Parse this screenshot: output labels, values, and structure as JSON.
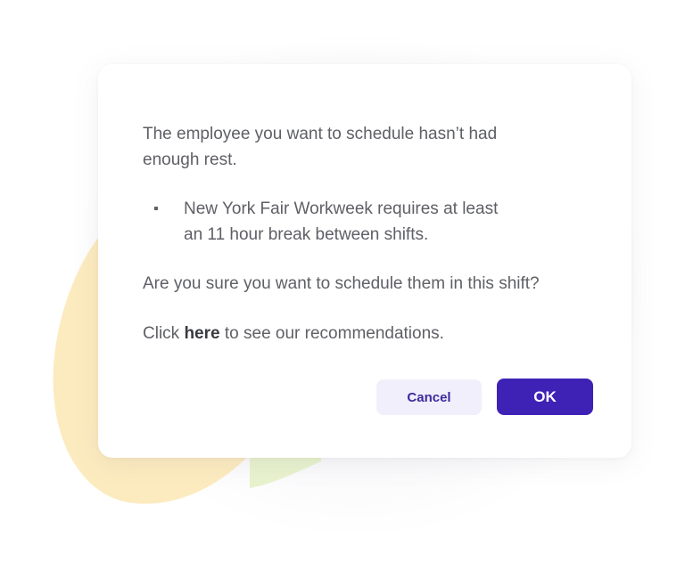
{
  "dialog": {
    "message_line1": "The employee you want to schedule hasn’t had",
    "message_line2": "enough rest.",
    "bullet_marker": "▪",
    "bullet_line1": "New York Fair Workweek requires at least",
    "bullet_line2": "an 11 hour break between shifts.",
    "question": "Are you sure you want to schedule them in this shift?",
    "click_prefix": "Click ",
    "click_link": "here",
    "click_suffix": " to see our recommendations.",
    "cancel_label": "Cancel",
    "ok_label": "OK"
  },
  "colors": {
    "primary": "#3e22b5",
    "secondary_bg": "#f1effb",
    "text": "#5f6066",
    "blob_yellow": "#fbe7b4",
    "blob_green": "#e8f2cd"
  }
}
